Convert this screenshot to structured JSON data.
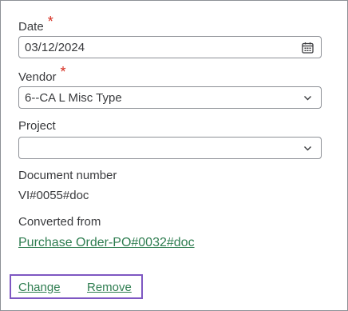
{
  "form": {
    "date": {
      "label": "Date",
      "required_mark": "*",
      "value": "03/12/2024",
      "icon": "calendar-icon"
    },
    "vendor": {
      "label": "Vendor",
      "required_mark": "*",
      "value": "6--CA L Misc Type",
      "icon": "chevron-down-icon"
    },
    "project": {
      "label": "Project",
      "value": "",
      "icon": "chevron-down-icon"
    },
    "document_number": {
      "label": "Document number",
      "value": "VI#0055#doc"
    },
    "converted_from": {
      "label": "Converted from",
      "link_text": "Purchase Order-PO#0032#doc"
    }
  },
  "actions": {
    "change_label": "Change",
    "remove_label": "Remove"
  },
  "colors": {
    "link": "#2e7d50",
    "required": "#d52b1e",
    "highlight_box": "#7e57c2",
    "border": "#8d9096"
  }
}
